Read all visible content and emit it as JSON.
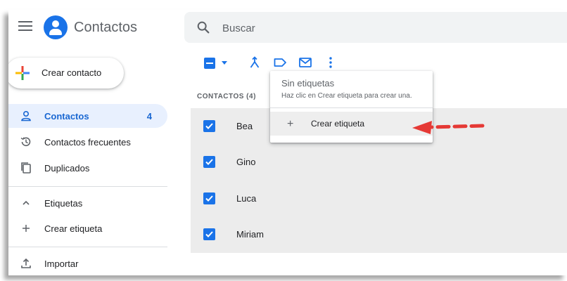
{
  "app": {
    "title": "Contactos"
  },
  "search": {
    "placeholder": "Buscar"
  },
  "create_button": {
    "label": "Crear contacto"
  },
  "sidebar": {
    "items": [
      {
        "label": "Contactos",
        "count": "4",
        "icon": "person-icon",
        "active": true
      },
      {
        "label": "Contactos frecuentes",
        "icon": "history-icon"
      },
      {
        "label": "Duplicados",
        "icon": "copy-icon"
      }
    ],
    "labels_section": {
      "label": "Etiquetas",
      "icon": "chevron-up-icon"
    },
    "create_label": {
      "label": "Crear etiqueta",
      "icon": "plus-icon"
    },
    "import": {
      "label": "Importar",
      "icon": "upload-icon"
    }
  },
  "toolbar": {
    "icons": [
      "select-all-checkbox",
      "merge-icon",
      "label-icon",
      "email-icon",
      "more-vert-icon"
    ]
  },
  "list": {
    "header": "CONTACTOS (4)",
    "rows": [
      {
        "name": "Bea",
        "checked": true
      },
      {
        "name": "Gino",
        "checked": true
      },
      {
        "name": "Luca",
        "checked": true
      },
      {
        "name": "Miriam",
        "checked": true
      }
    ]
  },
  "label_menu": {
    "title": "Sin etiquetas",
    "hint": "Haz clic en Crear etiqueta para crear una.",
    "create_label": "Crear etiqueta"
  },
  "colors": {
    "accent": "#1a73e8",
    "active_nav_bg": "#e8f0fe",
    "arrow": "#e53935"
  }
}
